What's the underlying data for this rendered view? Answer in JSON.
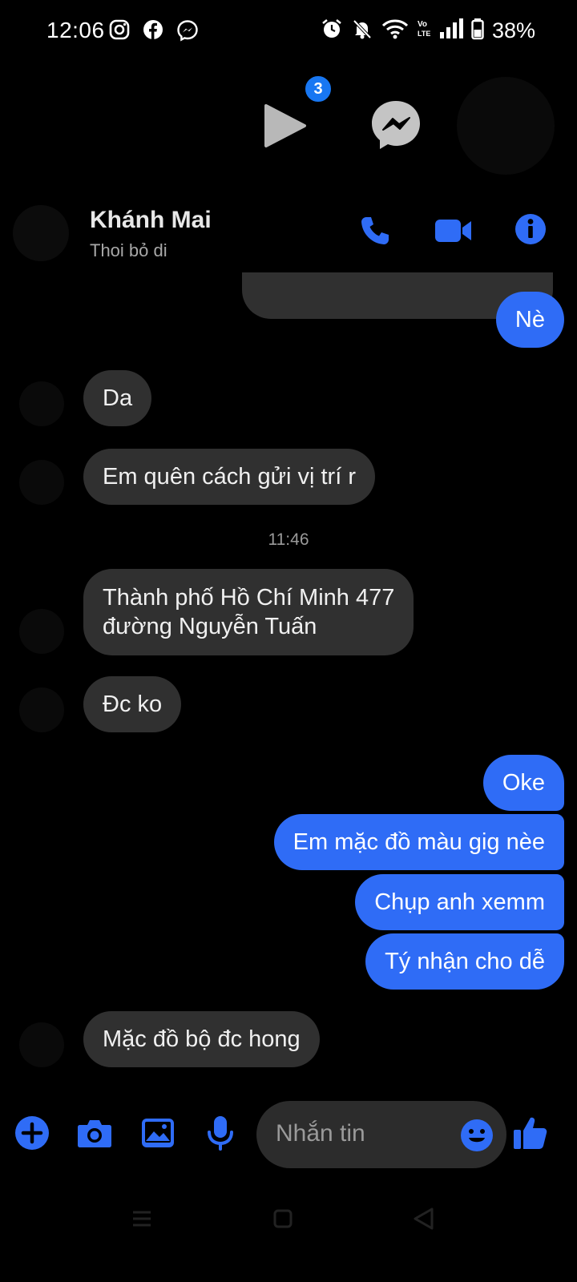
{
  "status_bar": {
    "time": "12:06",
    "battery": "38%"
  },
  "chat_heads": {
    "badge_count": "3"
  },
  "header": {
    "name": "Khánh Mai",
    "status": "Thoi bỏ di"
  },
  "messages": [
    {
      "dir": "out",
      "text": "Nè"
    },
    {
      "dir": "in",
      "text": "Da"
    },
    {
      "dir": "in",
      "text": "Em quên cách gửi vị trí r"
    },
    {
      "dir": "in",
      "text": "Thành phố Hồ Chí Minh 477",
      "line2": "đường Nguyễn Tuấn"
    },
    {
      "dir": "in",
      "text": "Đc ko"
    },
    {
      "dir": "out",
      "text": "Oke"
    },
    {
      "dir": "out",
      "text": "Em mặc đồ màu gig nèe"
    },
    {
      "dir": "out",
      "text": "Chụp anh xemm"
    },
    {
      "dir": "out",
      "text": "Tý nhận cho dễ"
    },
    {
      "dir": "in",
      "text": "Mặc đồ bộ đc hong"
    }
  ],
  "timestamp": "11:46",
  "composer": {
    "placeholder": "Nhắn tin"
  },
  "colors": {
    "accent": "#2f6cf6",
    "incoming": "#303030",
    "background": "#000000"
  },
  "icons": [
    "instagram-icon",
    "facebook-icon",
    "messenger-icon",
    "alarm-icon",
    "bell-off-icon",
    "wifi-icon",
    "volte-icon",
    "signal-icon",
    "battery-icon",
    "play-icon",
    "phone-icon",
    "video-icon",
    "info-icon",
    "plus-icon",
    "camera-icon",
    "image-icon",
    "mic-icon",
    "emoji-icon",
    "thumbs-up-icon"
  ]
}
